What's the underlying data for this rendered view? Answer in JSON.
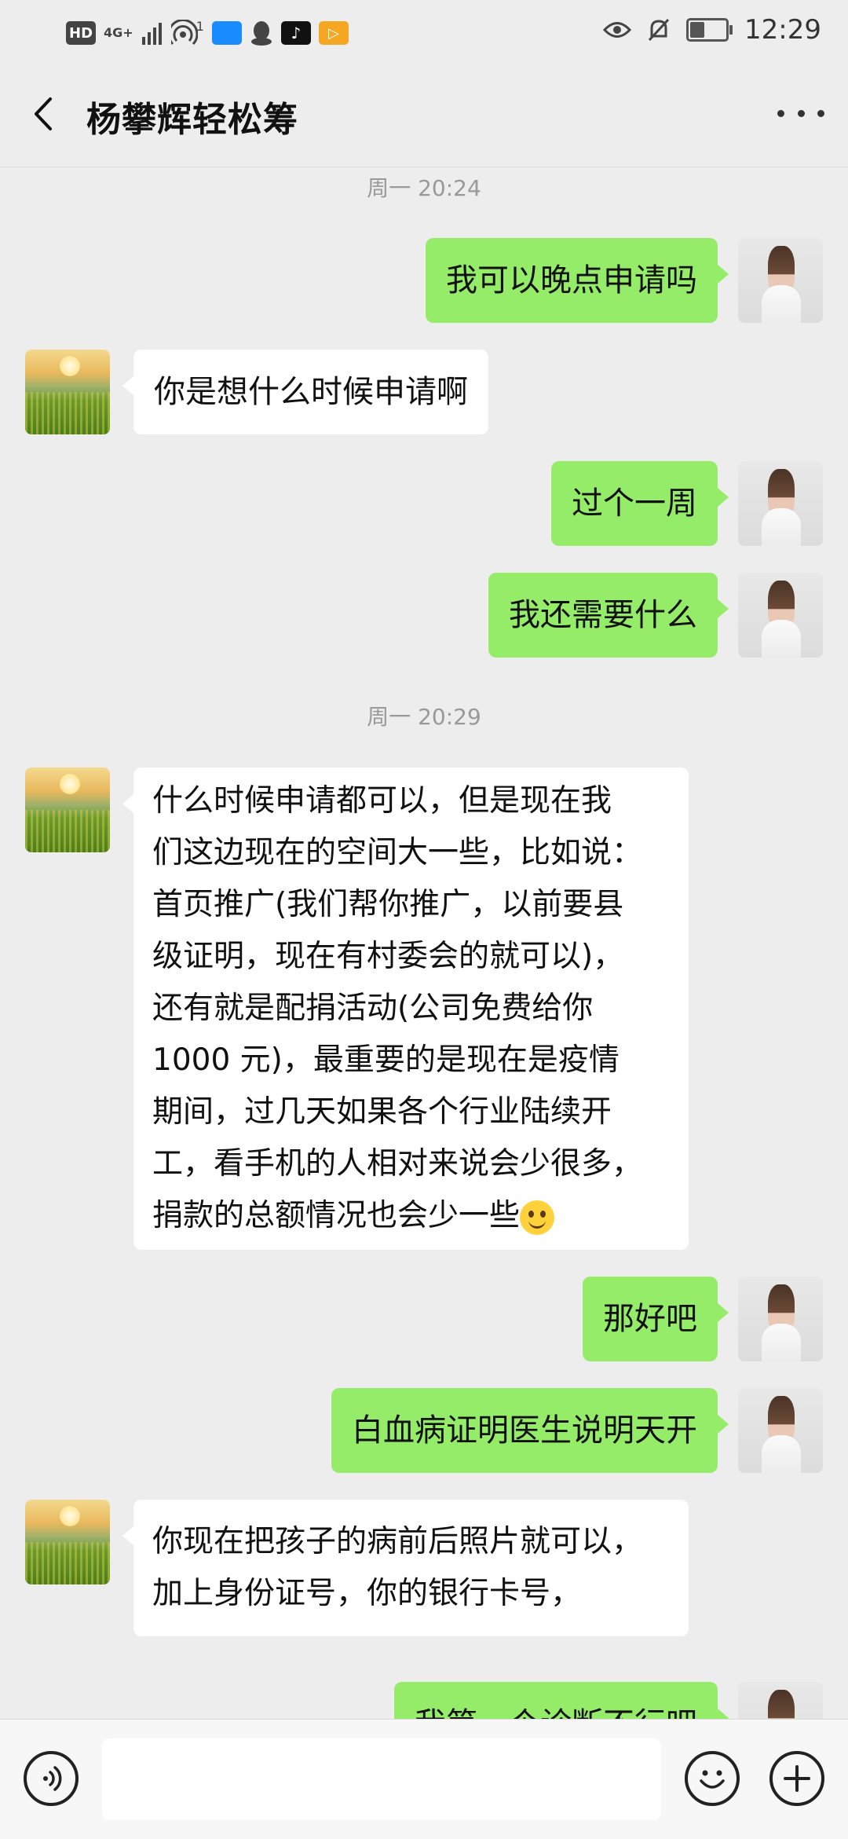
{
  "status_bar": {
    "left_icons": [
      "HD",
      "4G+",
      "signal-icon",
      "hotspot-icon",
      "app-icon",
      "qq-icon",
      "tiktok-icon",
      "video-app-icon"
    ],
    "hd_label": "HD",
    "network_label": "4G+",
    "hotspot_count": "1",
    "right_icons": [
      "eye-icon",
      "mute-icon",
      "battery-icon"
    ],
    "battery_level": 0.4,
    "time": "12:29"
  },
  "header": {
    "title": "杨攀辉轻松筹"
  },
  "messages": [
    {
      "type": "timestamp",
      "text": "周一 20:24"
    },
    {
      "type": "out",
      "text": "我可以晚点申请吗",
      "avatar": "girl-avatar"
    },
    {
      "type": "in",
      "text": "你是想什么时候申请啊",
      "avatar": "field-avatar"
    },
    {
      "type": "out",
      "text": "过个一周",
      "avatar": "girl-avatar"
    },
    {
      "type": "out",
      "text": "我还需要什么",
      "avatar": "girl-avatar"
    },
    {
      "type": "timestamp",
      "text": "周一 20:29"
    },
    {
      "type": "in",
      "text": "什么时候申请都可以，但是现在我\n们这边现在的空间大一些，比如说：\n首页推广(我们帮你推广，以前要县\n级证明，现在有村委会的就可以)，\n还有就是配捐活动(公司免费给你\n1000 元)，最重要的是现在是疫情\n期间，过几天如果各个行业陆续开\n工，看手机的人相对来说会少很多，\n捐款的总额情况也会少一些",
      "emoji": "smile-emoji",
      "avatar": "field-avatar"
    },
    {
      "type": "out",
      "text": "那好吧",
      "avatar": "girl-avatar"
    },
    {
      "type": "out",
      "text": "白血病证明医生说明天开",
      "avatar": "girl-avatar"
    },
    {
      "type": "in",
      "text": "你现在把孩子的病前后照片就可以，\n加上身份证号，你的银行卡号，",
      "avatar": "field-avatar"
    },
    {
      "type": "out",
      "text": "我第一个诊断不行吧",
      "avatar": "girl-avatar"
    }
  ],
  "input_bar": {
    "voice_button": "voice-icon",
    "emoji_button": "emoji-icon",
    "plus_button": "plus-icon",
    "input_value": ""
  },
  "colors": {
    "background": "#ededed",
    "outgoing_bubble": "#95ec69",
    "incoming_bubble": "#ffffff",
    "timestamp": "#999999"
  }
}
